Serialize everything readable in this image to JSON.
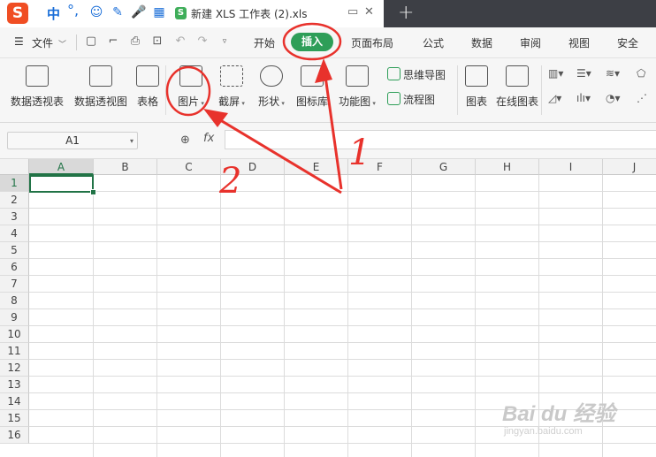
{
  "ime": {
    "logo": "S",
    "lang": "中",
    "punct": "°,",
    "icons": [
      "smiley-icon",
      "pen-icon",
      "mic-icon",
      "grid-icon"
    ]
  },
  "doc_tab": {
    "badge": "S",
    "title": "新建 XLS 工作表 (2).xls",
    "new_tab": "+"
  },
  "menu": {
    "file": "文件",
    "tabs": [
      "开始",
      "插入",
      "页面布局",
      "公式",
      "数据",
      "审阅",
      "视图",
      "安全"
    ],
    "active_tab": "插入"
  },
  "ribbon": {
    "pivot_table": "数据透视表",
    "pivot_chart": "数据透视图",
    "table": "表格",
    "picture": "图片",
    "screenshot": "截屏",
    "shape": "形状",
    "icon_lib": "图标库",
    "function_chart": "功能图",
    "mind_map": "思维导图",
    "flow_chart": "流程图",
    "chart": "图表",
    "online_chart": "在线图表"
  },
  "formula_bar": {
    "name_box": "A1",
    "fx": "fx",
    "value": ""
  },
  "grid": {
    "columns": [
      "A",
      "B",
      "C",
      "D",
      "E",
      "F",
      "G",
      "H",
      "I",
      "J"
    ],
    "rows": [
      "1",
      "2",
      "3",
      "4",
      "5",
      "6",
      "7",
      "8",
      "9",
      "10",
      "11",
      "12",
      "13",
      "14",
      "15",
      "16"
    ],
    "selected_cell": "A1"
  },
  "annotations": {
    "mark_1": "1",
    "mark_2": "2",
    "color": "#e8322c"
  },
  "watermark": {
    "brand": "Bai du 经验",
    "url": "jingyan.baidu.com"
  },
  "colors": {
    "accent": "#2e9e58",
    "titlebar": "#3d3f45",
    "selection": "#217346"
  }
}
